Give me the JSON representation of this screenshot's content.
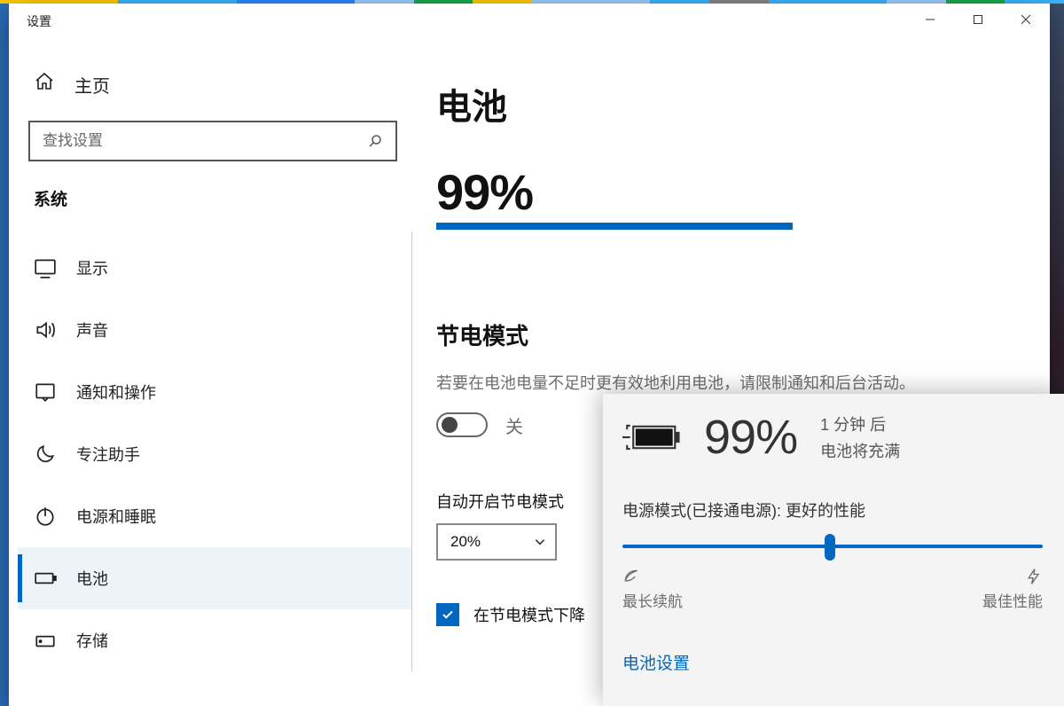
{
  "window": {
    "title": "设置"
  },
  "taskbar_colors": [
    "#ffcc00",
    "#ffcc00",
    "#3bb5ff",
    "#3bb5ff",
    "#2d89ff",
    "#2d89ff",
    "#9ad0ff",
    "#1aa94d",
    "#ffcc00",
    "#9ad0ff",
    "#9ad0ff",
    "#3bb5ff",
    "#888",
    "#3bb5ff",
    "#3bb5ff",
    "#9ad0ff",
    "#1aa94d",
    "#3bb5ff"
  ],
  "sidebar": {
    "home": "主页",
    "search_placeholder": "查找设置",
    "category": "系统",
    "items": [
      {
        "icon": "display",
        "label": "显示"
      },
      {
        "icon": "sound",
        "label": "声音"
      },
      {
        "icon": "notif",
        "label": "通知和操作"
      },
      {
        "icon": "moon",
        "label": "专注助手"
      },
      {
        "icon": "power",
        "label": "电源和睡眠"
      },
      {
        "icon": "battery",
        "label": "电池",
        "selected": true
      },
      {
        "icon": "storage",
        "label": "存储"
      }
    ]
  },
  "page": {
    "title": "电池",
    "percent": "99%",
    "saver_section": "节电模式",
    "saver_desc": "若要在电池电量不足时更有效地利用电池，请限制通知和后台活动。",
    "toggle_state": "关",
    "auto_label": "自动开启节电模式",
    "auto_value": "20%",
    "lower_checkbox": "在节电模式下降"
  },
  "flyout": {
    "percent": "99%",
    "remain1": "1 分钟  后",
    "remain2": "电池将充满",
    "mode_line": "电源模式(已接通电源): 更好的性能",
    "left_label": "最长续航",
    "right_label": "最佳性能",
    "link": "电池设置"
  }
}
